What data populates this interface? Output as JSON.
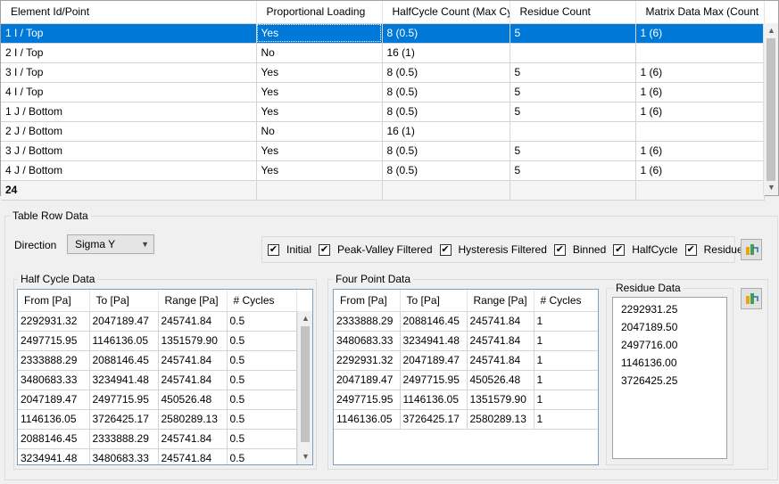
{
  "top_grid": {
    "columns": [
      "Element Id/Point",
      "Proportional Loading",
      "HalfCycle Count (Max Cy",
      "Residue Count",
      "Matrix Data Max (Count"
    ],
    "rows": [
      [
        "1 I / Top",
        "Yes",
        "8 (0.5)",
        "5",
        "1 (6)"
      ],
      [
        "2 I / Top",
        "No",
        "16 (1)",
        "",
        ""
      ],
      [
        "3 I / Top",
        "Yes",
        "8 (0.5)",
        "5",
        "1 (6)"
      ],
      [
        "4 I / Top",
        "Yes",
        "8 (0.5)",
        "5",
        "1 (6)"
      ],
      [
        "1 J / Bottom",
        "Yes",
        "8 (0.5)",
        "5",
        "1 (6)"
      ],
      [
        "2 J / Bottom",
        "No",
        "16 (1)",
        "",
        ""
      ],
      [
        "3 J / Bottom",
        "Yes",
        "8 (0.5)",
        "5",
        "1 (6)"
      ],
      [
        "4 J / Bottom",
        "Yes",
        "8 (0.5)",
        "5",
        "1 (6)"
      ]
    ],
    "total": "24"
  },
  "table_row_data": {
    "title": "Table Row Data",
    "direction_label": "Direction",
    "direction_value": "Sigma Y",
    "checkboxes": [
      {
        "label": "Initial",
        "checked": true
      },
      {
        "label": "Peak-Valley Filtered",
        "checked": true
      },
      {
        "label": "Hysteresis Filtered",
        "checked": true
      },
      {
        "label": "Binned",
        "checked": true
      },
      {
        "label": "HalfCycle",
        "checked": true
      },
      {
        "label": "Residue",
        "checked": true
      }
    ]
  },
  "half_cycle": {
    "title": "Half Cycle Data",
    "columns": [
      "From  [Pa]",
      "To  [Pa]",
      "Range  [Pa]",
      "# Cycles"
    ],
    "rows": [
      [
        "2292931.32",
        "2047189.47",
        "245741.84",
        "0.5"
      ],
      [
        "2497715.95",
        "1146136.05",
        "1351579.90",
        "0.5"
      ],
      [
        "2333888.29",
        "2088146.45",
        "245741.84",
        "0.5"
      ],
      [
        "3480683.33",
        "3234941.48",
        "245741.84",
        "0.5"
      ],
      [
        "2047189.47",
        "2497715.95",
        "450526.48",
        "0.5"
      ],
      [
        "1146136.05",
        "3726425.17",
        "2580289.13",
        "0.5"
      ],
      [
        "2088146.45",
        "2333888.29",
        "245741.84",
        "0.5"
      ],
      [
        "3234941.48",
        "3480683.33",
        "245741.84",
        "0.5"
      ]
    ]
  },
  "four_point": {
    "title": "Four Point Data",
    "columns": [
      "From  [Pa]",
      "To  [Pa]",
      "Range  [Pa]",
      "# Cycles"
    ],
    "rows": [
      [
        "2333888.29",
        "2088146.45",
        "245741.84",
        "1"
      ],
      [
        "3480683.33",
        "3234941.48",
        "245741.84",
        "1"
      ],
      [
        "2292931.32",
        "2047189.47",
        "245741.84",
        "1"
      ],
      [
        "2047189.47",
        "2497715.95",
        "450526.48",
        "1"
      ],
      [
        "2497715.95",
        "1146136.05",
        "1351579.90",
        "1"
      ],
      [
        "1146136.05",
        "3726425.17",
        "2580289.13",
        "1"
      ]
    ]
  },
  "residue": {
    "title": "Residue Data",
    "values": [
      "2292931.25",
      "2047189.50",
      "2497716.00",
      "1146136.00",
      "3726425.25"
    ]
  },
  "colors": {
    "selection": "#0078d7",
    "window": "#f0f0f0",
    "grid_border": "#d4d4d4"
  }
}
